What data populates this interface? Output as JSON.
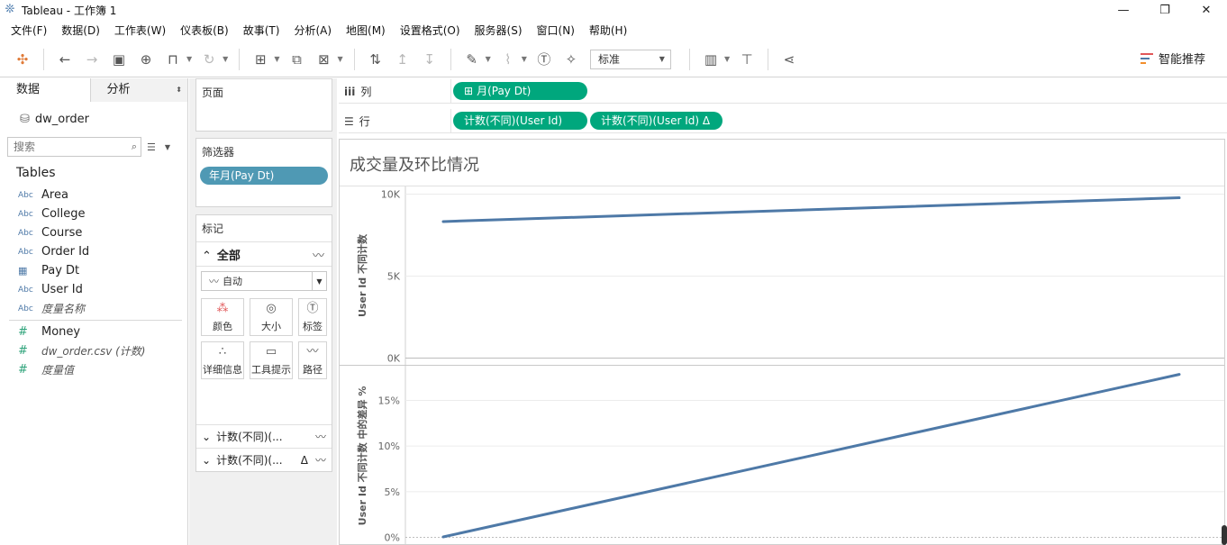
{
  "window": {
    "title": "Tableau - 工作簿 1",
    "minimize": "—",
    "restore": "❐",
    "close": "✕"
  },
  "menu": [
    "文件(F)",
    "数据(D)",
    "工作表(W)",
    "仪表板(B)",
    "故事(T)",
    "分析(A)",
    "地图(M)",
    "设置格式(O)",
    "服务器(S)",
    "窗口(N)",
    "帮助(H)"
  ],
  "toolbar": {
    "fit_select": "标准",
    "smart_label": "智能推荐"
  },
  "left_pane": {
    "tab_data": "数据",
    "tab_analysis": "分析",
    "datasource": "dw_order",
    "search_placeholder": "搜索",
    "tables_label": "Tables",
    "dimensions": [
      {
        "type": "Abc",
        "name": "Area"
      },
      {
        "type": "Abc",
        "name": "College"
      },
      {
        "type": "Abc",
        "name": "Course"
      },
      {
        "type": "Abc",
        "name": "Order Id"
      },
      {
        "type": "date",
        "name": "Pay Dt"
      },
      {
        "type": "Abc",
        "name": "User Id"
      },
      {
        "type": "Abc",
        "name": "度量名称"
      }
    ],
    "measures": [
      {
        "type": "#",
        "name": "Money"
      },
      {
        "type": "#",
        "name": "dw_order.csv (计数)"
      },
      {
        "type": "#",
        "name": "度量值"
      }
    ]
  },
  "shelves": {
    "pages_title": "页面",
    "filters_title": "筛选器",
    "filter_pill": "年月(Pay Dt)",
    "marks_title": "标记",
    "marks_all": "全部",
    "marks_type": "自动",
    "mark_buttons": [
      {
        "label": "颜色"
      },
      {
        "label": "大小"
      },
      {
        "label": "标签"
      },
      {
        "label": "详细信息"
      },
      {
        "label": "工具提示"
      },
      {
        "label": "路径"
      }
    ],
    "measure_rows": [
      "计数(不同)(...",
      "计数(不同)(..."
    ],
    "delta_symbol": "Δ",
    "columns_label": "列",
    "rows_label": "行",
    "column_pill": "月(Pay Dt)",
    "row_pills": [
      "计数(不同)(User Id)",
      "计数(不同)(User Id)  Δ"
    ]
  },
  "view": {
    "title": "成交量及环比情况"
  },
  "chart_data": [
    {
      "type": "line",
      "ylabel": "User Id 不同计数",
      "ylim": [
        0,
        10000
      ],
      "yticks": [
        "0K",
        "5K",
        "10K"
      ],
      "series": [
        {
          "values": [
            8300,
            9750
          ]
        }
      ],
      "color": "#4e79a7"
    },
    {
      "type": "line",
      "ylabel": "User Id 不同计数 中的差异 %",
      "ylim": [
        0,
        0.18
      ],
      "yticks": [
        "0%",
        "5%",
        "10%",
        "15%"
      ],
      "series": [
        {
          "values": [
            0,
            0.178
          ]
        }
      ],
      "color": "#4e79a7"
    }
  ],
  "colors": {
    "pill_green": "#00a77d",
    "filter_blue": "#4f99b4",
    "line_blue": "#4e79a7"
  }
}
